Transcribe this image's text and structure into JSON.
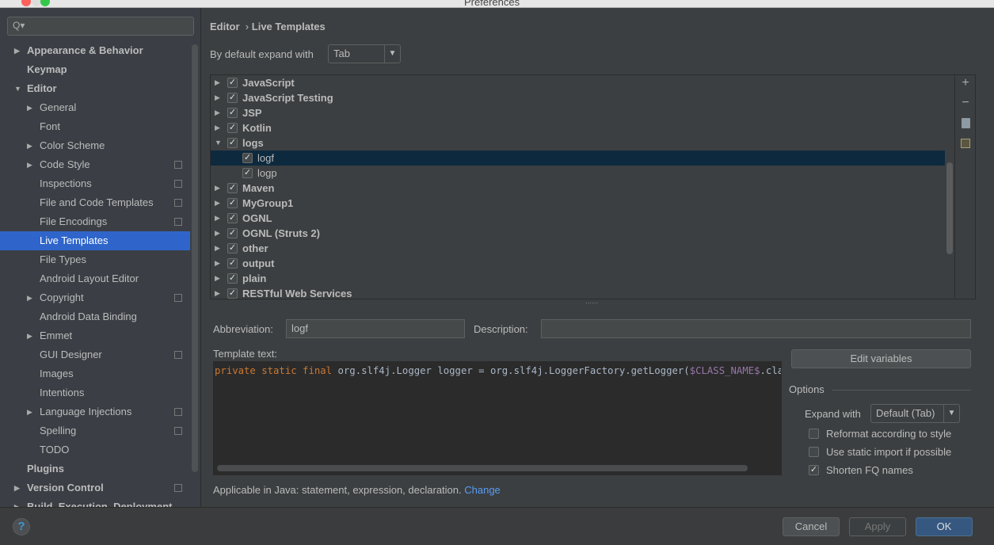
{
  "window": {
    "title": "Preferences"
  },
  "search": {
    "placeholder": "Q▾"
  },
  "sidebar": {
    "items": [
      {
        "label": "Appearance & Behavior",
        "level": 0,
        "arrow": "▶",
        "bold": true
      },
      {
        "label": "Keymap",
        "level": 0,
        "bold": true
      },
      {
        "label": "Editor",
        "level": 0,
        "arrow": "▼",
        "bold": true
      },
      {
        "label": "General",
        "level": 1,
        "arrow": "▶"
      },
      {
        "label": "Font",
        "level": 1
      },
      {
        "label": "Color Scheme",
        "level": 1,
        "arrow": "▶"
      },
      {
        "label": "Code Style",
        "level": 1,
        "arrow": "▶",
        "copy": true
      },
      {
        "label": "Inspections",
        "level": 1,
        "copy": true
      },
      {
        "label": "File and Code Templates",
        "level": 1,
        "copy": true
      },
      {
        "label": "File Encodings",
        "level": 1,
        "copy": true
      },
      {
        "label": "Live Templates",
        "level": 1,
        "selected": true
      },
      {
        "label": "File Types",
        "level": 1
      },
      {
        "label": "Android Layout Editor",
        "level": 1
      },
      {
        "label": "Copyright",
        "level": 1,
        "arrow": "▶",
        "copy": true
      },
      {
        "label": "Android Data Binding",
        "level": 1
      },
      {
        "label": "Emmet",
        "level": 1,
        "arrow": "▶"
      },
      {
        "label": "GUI Designer",
        "level": 1,
        "copy": true
      },
      {
        "label": "Images",
        "level": 1
      },
      {
        "label": "Intentions",
        "level": 1
      },
      {
        "label": "Language Injections",
        "level": 1,
        "arrow": "▶",
        "copy": true
      },
      {
        "label": "Spelling",
        "level": 1,
        "copy": true
      },
      {
        "label": "TODO",
        "level": 1
      },
      {
        "label": "Plugins",
        "level": 0,
        "bold": true
      },
      {
        "label": "Version Control",
        "level": 0,
        "arrow": "▶",
        "bold": true,
        "copy": true
      },
      {
        "label": "Build, Execution, Deployment",
        "level": 0,
        "arrow": "▶",
        "bold": true
      }
    ]
  },
  "breadcrumb": {
    "parent": "Editor",
    "sep": "›",
    "current": "Live Templates"
  },
  "expand": {
    "label": "By default expand with",
    "value": "Tab"
  },
  "tree": {
    "rows": [
      {
        "label": "JavaScript",
        "arrow": "▶",
        "checked": true,
        "level": 0
      },
      {
        "label": "JavaScript Testing",
        "arrow": "▶",
        "checked": true,
        "level": 0
      },
      {
        "label": "JSP",
        "arrow": "▶",
        "checked": true,
        "level": 0
      },
      {
        "label": "Kotlin",
        "arrow": "▶",
        "checked": true,
        "level": 0
      },
      {
        "label": "logs",
        "arrow": "▼",
        "checked": true,
        "level": 0
      },
      {
        "label": "logf",
        "checked": true,
        "level": 1,
        "selected": true
      },
      {
        "label": "logp",
        "checked": true,
        "level": 1
      },
      {
        "label": "Maven",
        "arrow": "▶",
        "checked": true,
        "level": 0
      },
      {
        "label": "MyGroup1",
        "arrow": "▶",
        "checked": true,
        "level": 0
      },
      {
        "label": "OGNL",
        "arrow": "▶",
        "checked": true,
        "level": 0
      },
      {
        "label": "OGNL (Struts 2)",
        "arrow": "▶",
        "checked": true,
        "level": 0
      },
      {
        "label": "other",
        "arrow": "▶",
        "checked": true,
        "level": 0
      },
      {
        "label": "output",
        "arrow": "▶",
        "checked": true,
        "level": 0
      },
      {
        "label": "plain",
        "arrow": "▶",
        "checked": true,
        "level": 0
      },
      {
        "label": "RESTful Web Services",
        "arrow": "▶",
        "checked": true,
        "level": 0
      }
    ]
  },
  "toolbar": {
    "add": "+",
    "remove": "−"
  },
  "abbreviation": {
    "label": "Abbreviation:",
    "value": "logf"
  },
  "description": {
    "label": "Description:",
    "value": ""
  },
  "template": {
    "label": "Template text:",
    "kw": "private static final",
    "plain1": " org.slf4j.Logger logger = org.slf4j.LoggerFactory.getLogger(",
    "var": "$CLASS_NAME$",
    "plain2": ".class);"
  },
  "edit_variables": "Edit variables",
  "options": {
    "title": "Options",
    "expand_label": "Expand with",
    "expand_value": "Default (Tab)",
    "checks": [
      {
        "label": "Reformat according to style",
        "checked": false
      },
      {
        "label": "Use static import if possible",
        "checked": false
      },
      {
        "label": "Shorten FQ names",
        "checked": true
      }
    ]
  },
  "applicable": {
    "text": "Applicable in Java: statement, expression, declaration.",
    "link": "Change"
  },
  "footer": {
    "help": "?",
    "cancel": "Cancel",
    "apply": "Apply",
    "ok": "OK"
  },
  "colors": {
    "accent": "#2f65ca",
    "link": "#589df6",
    "keyword": "#cc7832",
    "variable": "#9876aa"
  }
}
